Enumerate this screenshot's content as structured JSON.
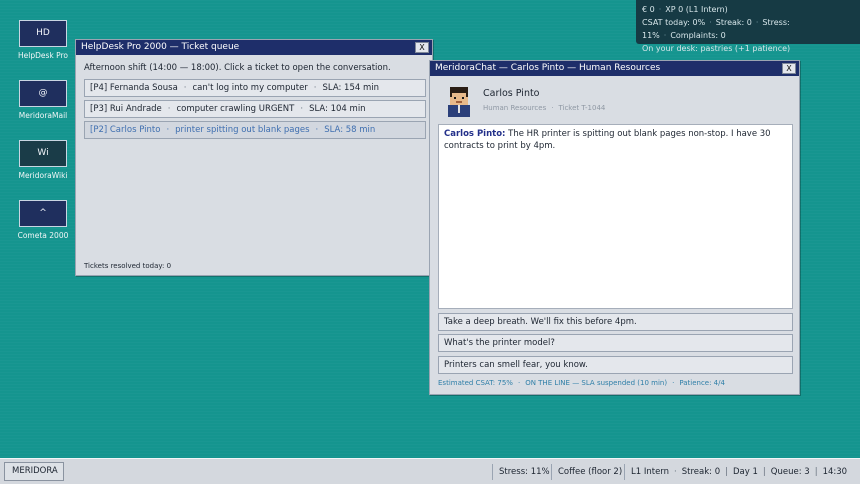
{
  "hud": {
    "money": "€ 0",
    "xp": "XP 0 (L1 Intern)",
    "csat": "CSAT today: 0%",
    "streak": "Streak: 0",
    "stress": "Stress: 11%",
    "complaints": "Complaints: 0",
    "desk": "On your desk: pastries (+1 patience)"
  },
  "desktop": {
    "icons": [
      {
        "glyph": "HD",
        "label": "HelpDesk Pro"
      },
      {
        "glyph": "@",
        "label": "MeridoraMail"
      },
      {
        "glyph": "Wi",
        "label": "MeridoraWiki"
      },
      {
        "glyph": "^",
        "label": "Cometa 2000"
      }
    ]
  },
  "queue_window": {
    "title": "HelpDesk Pro 2000 — Ticket queue",
    "close": "X",
    "intro": "Afternoon shift (14:00 — 18:00). Click a ticket to open the conversation.",
    "tickets": [
      {
        "priority": "[P4]",
        "name": "Fernanda Sousa",
        "issue": "can't log into my computer",
        "sla": "SLA: 154 min"
      },
      {
        "priority": "[P3]",
        "name": "Rui Andrade",
        "issue": "computer crawling URGENT",
        "sla": "SLA: 104 min"
      },
      {
        "priority": "[P2]",
        "name": "Carlos Pinto",
        "issue": "printer spitting out blank pages",
        "sla": "SLA: 58 min"
      }
    ],
    "resolved": "Tickets resolved today: 0"
  },
  "chat_window": {
    "title": "MeridoraChat — Carlos Pinto — Human Resources",
    "close": "X",
    "contact_name": "Carlos Pinto",
    "department": "Human Resources",
    "ticket": "Ticket T-1044",
    "message_sender": "Carlos Pinto:",
    "message_text": "The HR printer is spitting out blank pages non-stop. I have 30 contracts to print by 4pm.",
    "replies": [
      "Take a deep breath. We'll fix this before 4pm.",
      "What's the printer model?",
      "Printers can smell fear, you know."
    ],
    "status": {
      "csat": "Estimated CSAT: 75%",
      "line": "ON THE LINE — SLA suspended (10 min)",
      "patience": "Patience: 4/4"
    }
  },
  "taskbar": {
    "start": "MERIDORA",
    "stress": "Stress: 11%",
    "location": "Coffee (floor 2)",
    "level": "L1 Intern",
    "streak": "Streak: 0",
    "day": "Day 1",
    "queue": "Queue: 3",
    "clock": "14:30"
  },
  "colors": {
    "desktop": "#15958f",
    "titlebar": "#1e2e6a",
    "hud": "#163a44",
    "accent_link": "#3f6fb0",
    "status_text": "#2f7fa8"
  }
}
